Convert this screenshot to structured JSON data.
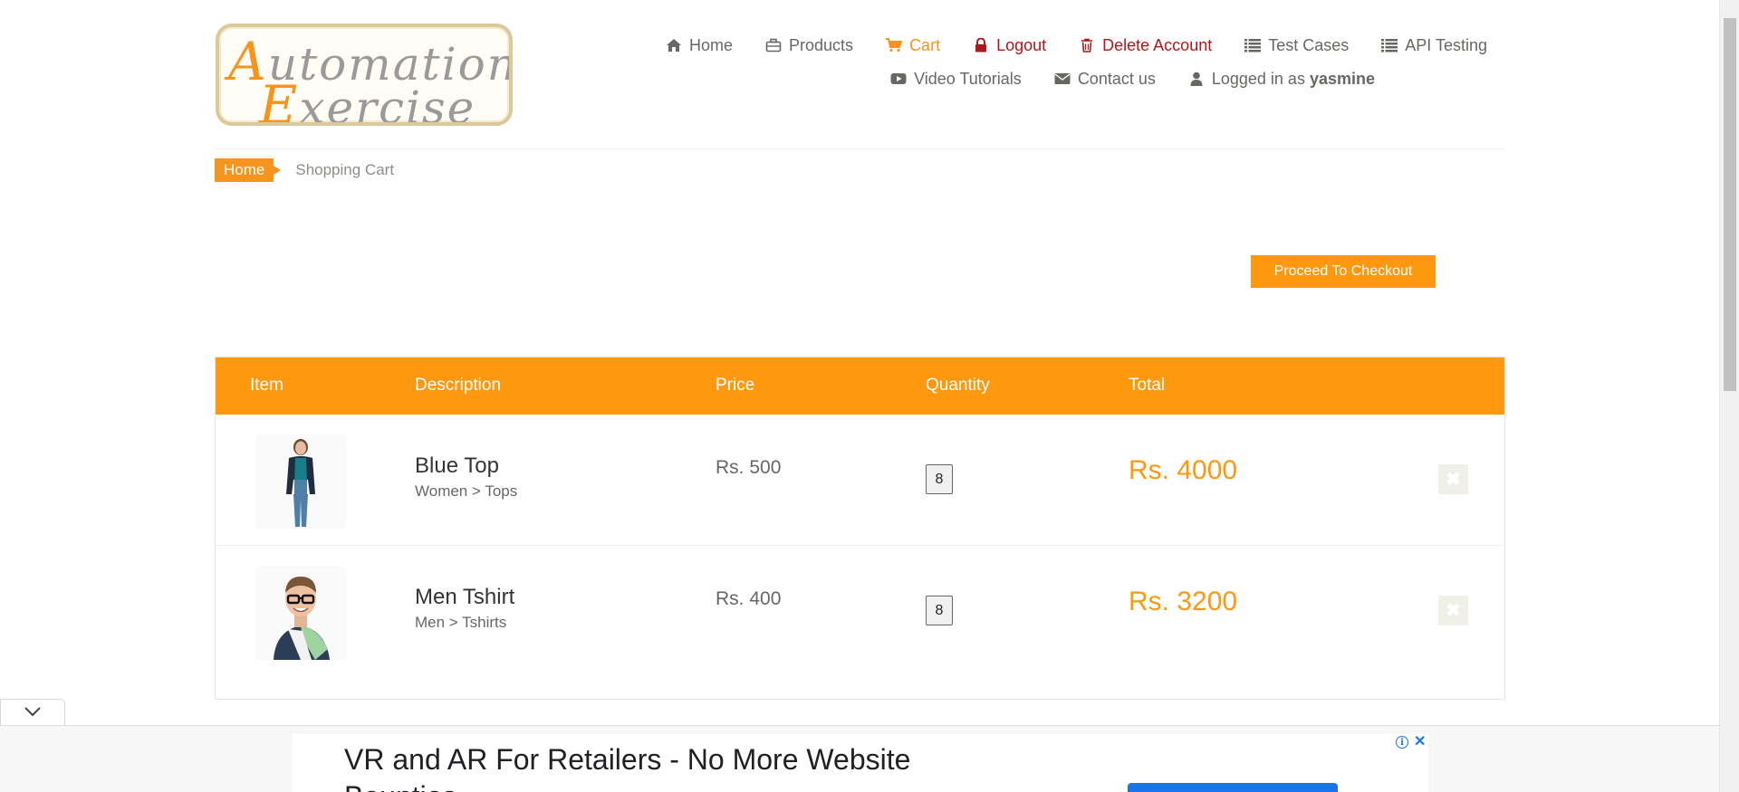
{
  "brand": {
    "logo_line1_cap": "A",
    "logo_line1_rest": "utomation",
    "logo_line2_cap": "E",
    "logo_line2_rest": "xercise",
    "accent_color": "#fe980f"
  },
  "nav": {
    "row1": [
      {
        "label": "Home",
        "icon": "home-icon"
      },
      {
        "label": "Products",
        "icon": "briefcase-icon"
      },
      {
        "label": "Cart",
        "icon": "cart-icon",
        "active": true
      },
      {
        "label": "Logout",
        "icon": "lock-icon"
      },
      {
        "label": "Delete Account",
        "icon": "trash-icon"
      },
      {
        "label": "Test Cases",
        "icon": "list-icon"
      },
      {
        "label": "API Testing",
        "icon": "list-icon"
      }
    ],
    "row2": [
      {
        "label": "Video Tutorials",
        "icon": "youtube-icon"
      },
      {
        "label": "Contact us",
        "icon": "envelope-icon"
      },
      {
        "label": "Logged in as",
        "icon": "user-icon"
      }
    ],
    "username": "yasmine"
  },
  "breadcrumb": {
    "home": "Home",
    "current": "Shopping Cart"
  },
  "checkout": {
    "label": "Proceed To Checkout"
  },
  "cart": {
    "headers": {
      "item": "Item",
      "description": "Description",
      "price": "Price",
      "quantity": "Quantity",
      "total": "Total"
    },
    "rows": [
      {
        "name": "Blue Top",
        "category": "Women > Tops",
        "price": "Rs. 500",
        "quantity": "8",
        "total": "Rs. 4000",
        "delete": "✖",
        "image": "woman-product-image"
      },
      {
        "name": "Men Tshirt",
        "category": "Men > Tshirts",
        "price": "Rs. 400",
        "quantity": "8",
        "total": "Rs. 3200",
        "delete": "✖",
        "image": "man-product-image"
      }
    ]
  },
  "ad": {
    "title_line1": "VR and AR For Retailers - No More Website",
    "title_line2": "Bounties",
    "info_glyph": "i",
    "close_glyph": "✕"
  }
}
